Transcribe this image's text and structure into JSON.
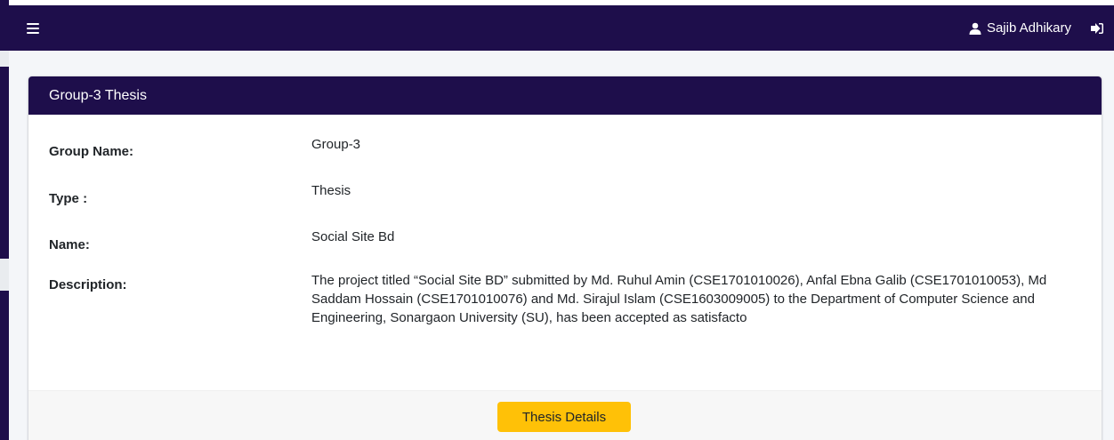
{
  "topbar": {
    "menu_icon": "hamburger-icon",
    "user_icon": "user-icon",
    "user_name": "Sajib Adhikary",
    "logout_icon": "sign-out-icon",
    "background": "#1e0e4b"
  },
  "card": {
    "title": "Group-3 Thesis",
    "fields": [
      {
        "label": "Group Name:",
        "value": "Group-3"
      },
      {
        "label": "Type :",
        "value": "Thesis"
      },
      {
        "label": "Name:",
        "value": "Social Site Bd"
      },
      {
        "label": "Description:",
        "value": "The project titled “Social Site BD” submitted by Md. Ruhul Amin (CSE1701010026), Anfal Ebna Galib (CSE1701010053), Md Saddam Hossain (CSE1701010076) and Md. Sirajul Islam (CSE1603009005) to the Department of Computer Science and Engineering, Sonargaon University (SU), has been accepted as satisfacto"
      }
    ],
    "button_label": "Thesis Details",
    "button_color": "#ffc107"
  }
}
